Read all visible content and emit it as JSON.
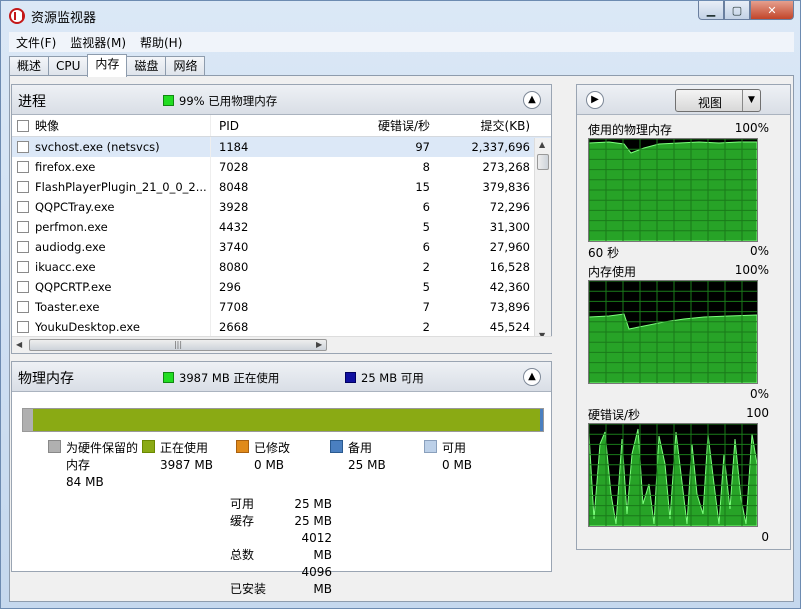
{
  "window": {
    "title": "资源监视器"
  },
  "menu": [
    {
      "label": "文件(F)"
    },
    {
      "label": "监视器(M)"
    },
    {
      "label": "帮助(H)"
    }
  ],
  "tabs": [
    {
      "label": "概述"
    },
    {
      "label": "CPU"
    },
    {
      "label": "内存",
      "active": true
    },
    {
      "label": "磁盘"
    },
    {
      "label": "网络"
    }
  ],
  "processes": {
    "title": "进程",
    "status": "99% 已用物理内存",
    "status_color": "#22dd22",
    "columns": {
      "image": "映像",
      "pid": "PID",
      "hard_faults": "硬错误/秒",
      "commit": "提交(KB)"
    },
    "rows": [
      {
        "image": "svchost.exe (netsvcs)",
        "pid": "1184",
        "hard_faults": "97",
        "commit": "2,337,696"
      },
      {
        "image": "firefox.exe",
        "pid": "7028",
        "hard_faults": "8",
        "commit": "273,268"
      },
      {
        "image": "FlashPlayerPlugin_21_0_0_2...",
        "pid": "8048",
        "hard_faults": "15",
        "commit": "379,836"
      },
      {
        "image": "QQPCTray.exe",
        "pid": "3928",
        "hard_faults": "6",
        "commit": "72,296"
      },
      {
        "image": "perfmon.exe",
        "pid": "4432",
        "hard_faults": "5",
        "commit": "31,300"
      },
      {
        "image": "audiodg.exe",
        "pid": "3740",
        "hard_faults": "6",
        "commit": "27,960"
      },
      {
        "image": "ikuacc.exe",
        "pid": "8080",
        "hard_faults": "2",
        "commit": "16,528"
      },
      {
        "image": "QQPCRTP.exe",
        "pid": "296",
        "hard_faults": "5",
        "commit": "42,360"
      },
      {
        "image": "Toaster.exe",
        "pid": "7708",
        "hard_faults": "7",
        "commit": "73,896"
      },
      {
        "image": "YoukuDesktop.exe",
        "pid": "2668",
        "hard_faults": "2",
        "commit": "45,524"
      }
    ]
  },
  "physical": {
    "title": "物理内存",
    "in_use_label": "3987 MB 正在使用",
    "available_label": "25 MB 可用",
    "colors": {
      "reserved": "#b0b0b0",
      "in_use": "#8aaa14",
      "modified": "#e08a1a",
      "standby": "#4a7fc0",
      "free": "#bcd0e8",
      "in_use_legend": "#22dd22",
      "available_legend": "#1010a0"
    },
    "bar": {
      "reserved_pct": 2.0,
      "in_use_pct": 97.4,
      "modified_pct": 0,
      "standby_pct": 0.6,
      "free_pct": 0
    },
    "legend": [
      {
        "label": "为硬件保留的",
        "label2": "内存",
        "value": "84 MB"
      },
      {
        "label": "正在使用",
        "value": "3987 MB"
      },
      {
        "label": "已修改",
        "value": "0 MB"
      },
      {
        "label": "备用",
        "value": "25 MB"
      },
      {
        "label": "可用",
        "value": "0 MB"
      }
    ],
    "stats": [
      {
        "label": "可用",
        "value": "25 MB"
      },
      {
        "label": "缓存",
        "value": "25 MB"
      },
      {
        "label": "总数",
        "value": "4012 MB"
      },
      {
        "label": "已安装",
        "value": "4096 MB"
      }
    ]
  },
  "right": {
    "view_label": "视图",
    "graphs": [
      {
        "title": "使用的物理内存",
        "max": "100%",
        "bottom_left": "60 秒",
        "bottom_right": "0%"
      },
      {
        "title": "内存使用",
        "max": "100%",
        "bottom_left": "",
        "bottom_right": "0%"
      },
      {
        "title": "硬错误/秒",
        "max": "100",
        "bottom_left": "",
        "bottom_right": "0"
      }
    ]
  }
}
